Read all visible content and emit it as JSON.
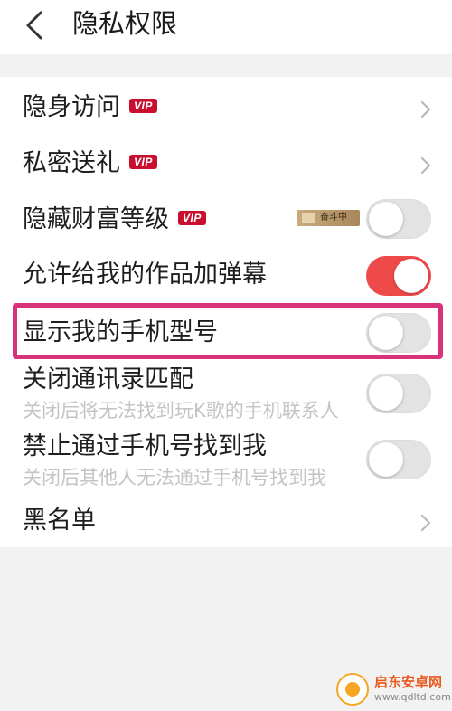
{
  "header": {
    "back_icon": "chevron-left-icon",
    "title": "隐私权限"
  },
  "settings": [
    {
      "label": "隐身访问",
      "vip": "VIP",
      "control": "chevron"
    },
    {
      "label": "私密送礼",
      "vip": "VIP",
      "control": "chevron"
    },
    {
      "label": "隐藏财富等级",
      "vip": "VIP",
      "tag": "奋斗中",
      "control": "toggle",
      "on": false
    },
    {
      "label": "允许给我的作品加弹幕",
      "control": "toggle",
      "on": true
    },
    {
      "label": "显示我的手机型号",
      "control": "toggle",
      "on": false,
      "highlighted": true
    },
    {
      "label": "关闭通讯录匹配",
      "sub": "关闭后将无法找到玩K歌的手机联系人",
      "control": "toggle",
      "on": false
    },
    {
      "label": "禁止通过手机号找到我",
      "sub": "关闭后其他人无法通过手机号找到我",
      "control": "toggle",
      "on": false
    },
    {
      "label": "黑名单",
      "control": "chevron"
    }
  ],
  "colors": {
    "toggle_on": "#ef4a4a",
    "highlight_border": "#d8337a",
    "vip_badge": "#c8102e"
  },
  "watermark": {
    "name": "启东安卓网",
    "url": "www.qdltd.com"
  }
}
